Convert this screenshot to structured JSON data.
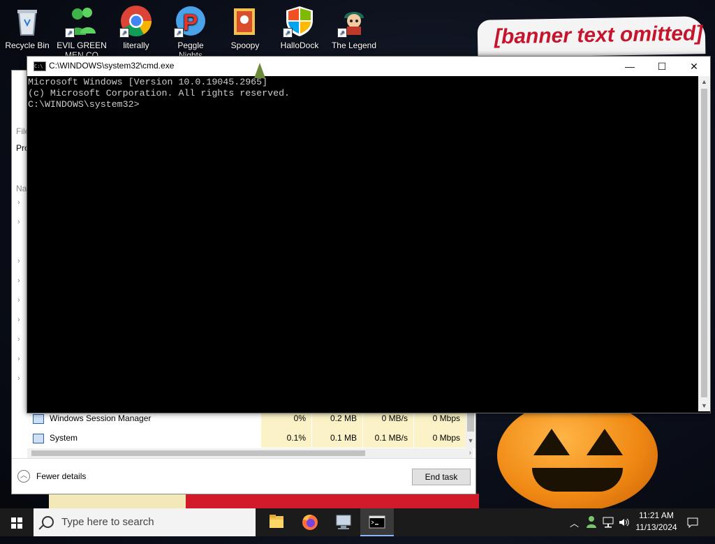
{
  "desktop": {
    "icons": [
      {
        "label": "Recycle Bin"
      },
      {
        "label": "EVIL GREEN MEN CO"
      },
      {
        "label": "literally"
      },
      {
        "label": "Peggle Nights"
      },
      {
        "label": "Spoopy"
      },
      {
        "label": "HalloDock"
      },
      {
        "label": "The Legend"
      }
    ],
    "banner_text": "[banner text omitted]"
  },
  "cmd": {
    "title": "C:\\WINDOWS\\system32\\cmd.exe",
    "lines": [
      "Microsoft Windows [Version 10.0.19045.2965]",
      "(c) Microsoft Corporation. All rights reserved.",
      "",
      "C:\\WINDOWS\\system32>"
    ],
    "minimize": "—",
    "maximize": "☐",
    "close": "✕"
  },
  "task_manager": {
    "left_fragments": [
      "File",
      "Pro",
      "Na"
    ],
    "rows": [
      {
        "name": "Windows Session Manager",
        "cpu": "0%",
        "memory": "0.2 MB",
        "disk": "0 MB/s",
        "network": "0 Mbps"
      },
      {
        "name": "System",
        "cpu": "0.1%",
        "memory": "0.1 MB",
        "disk": "0.1 MB/s",
        "network": "0 Mbps"
      }
    ],
    "fewer_details": "Fewer details",
    "end_task": "End task"
  },
  "taskbar": {
    "search_placeholder": "Type here to search",
    "time": "11:21 AM",
    "date": "11/13/2024",
    "apps": [
      "file-explorer",
      "firefox",
      "remote-desktop",
      "command-prompt"
    ]
  },
  "colors": {
    "console_bg": "#000000",
    "console_text": "#cccccc",
    "taskbar_bg": "#1b1b1b",
    "heat_cell": "#fbf3c7"
  }
}
